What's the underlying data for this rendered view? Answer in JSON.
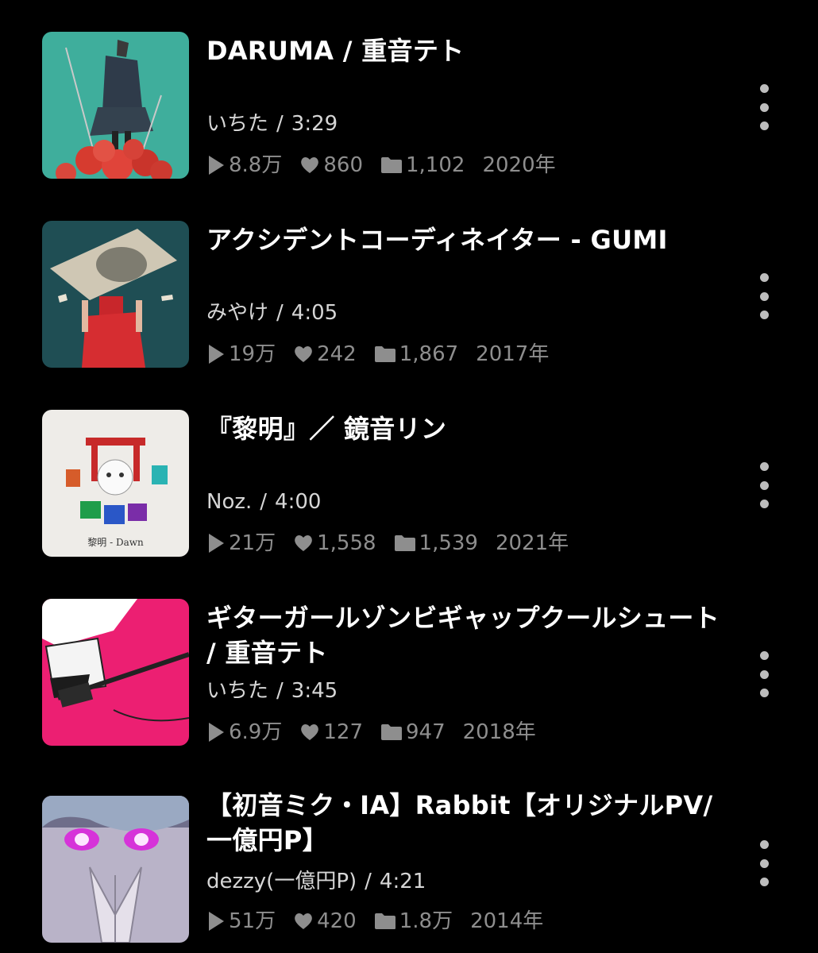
{
  "items": [
    {
      "title": "DARUMA / 重音テト",
      "artist": "いちた",
      "duration": "3:29",
      "plays": "8.8万",
      "likes": "860",
      "mylists": "1,102",
      "year": "2020年"
    },
    {
      "title": "アクシデントコーディネイター - GUMI",
      "artist": "みやけ",
      "duration": "4:05",
      "plays": "19万",
      "likes": "242",
      "mylists": "1,867",
      "year": "2017年"
    },
    {
      "title": "『黎明』／ 鏡音リン",
      "artist": "Noz.",
      "duration": "4:00",
      "plays": "21万",
      "likes": "1,558",
      "mylists": "1,539",
      "year": "2021年",
      "thumb_caption": "黎明 - Dawn"
    },
    {
      "title": "ギターガールゾンビギャップクールシュート / 重音テト",
      "artist": "いちた",
      "duration": "3:45",
      "plays": "6.9万",
      "likes": "127",
      "mylists": "947",
      "year": "2018年"
    },
    {
      "title": "【初音ミク・IA】Rabbit【オリジナルPV/一億円P】",
      "artist": "dezzy(一億円P)",
      "duration": "4:21",
      "plays": "51万",
      "likes": "420",
      "mylists": "1.8万",
      "year": "2014年"
    }
  ],
  "separator": "/",
  "icons": {
    "plays": "play-icon",
    "likes": "heart-icon",
    "mylists": "folder-icon",
    "more": "more-vertical-icon"
  },
  "colors": {
    "background": "#000000",
    "title": "#ffffff",
    "subtitle": "#d6d6d6",
    "stats": "#8e8e8e"
  }
}
